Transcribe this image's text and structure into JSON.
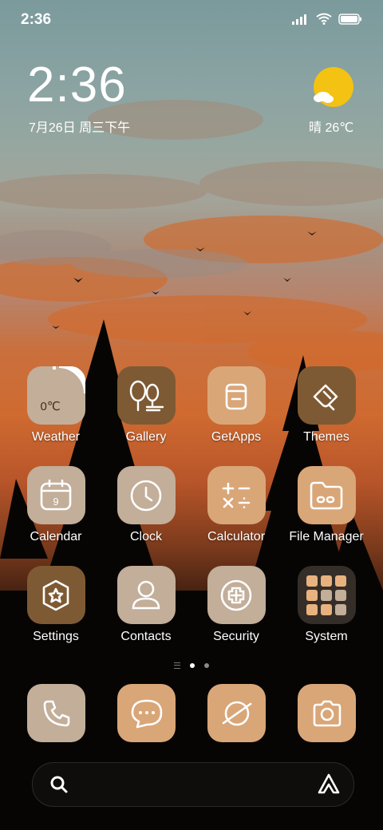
{
  "status_bar": {
    "time": "2:36"
  },
  "clock_widget": {
    "time": "2:36",
    "date": "7月26日 周三下午",
    "weather": "晴 26℃"
  },
  "apps": {
    "weather": {
      "label": "Weather",
      "temp": "0℃"
    },
    "gallery": {
      "label": "Gallery"
    },
    "getapps": {
      "label": "GetApps"
    },
    "themes": {
      "label": "Themes"
    },
    "calendar": {
      "label": "Calendar",
      "day": "9"
    },
    "clock": {
      "label": "Clock"
    },
    "calculator": {
      "label": "Calculator"
    },
    "file_manager": {
      "label": "File Manager"
    },
    "settings": {
      "label": "Settings"
    },
    "contacts": {
      "label": "Contacts"
    },
    "security": {
      "label": "Security"
    },
    "system": {
      "label": "System"
    }
  },
  "colors": {
    "beige": "#c2ae99",
    "brown": "#7d5a34",
    "tan": "#d9a678"
  }
}
